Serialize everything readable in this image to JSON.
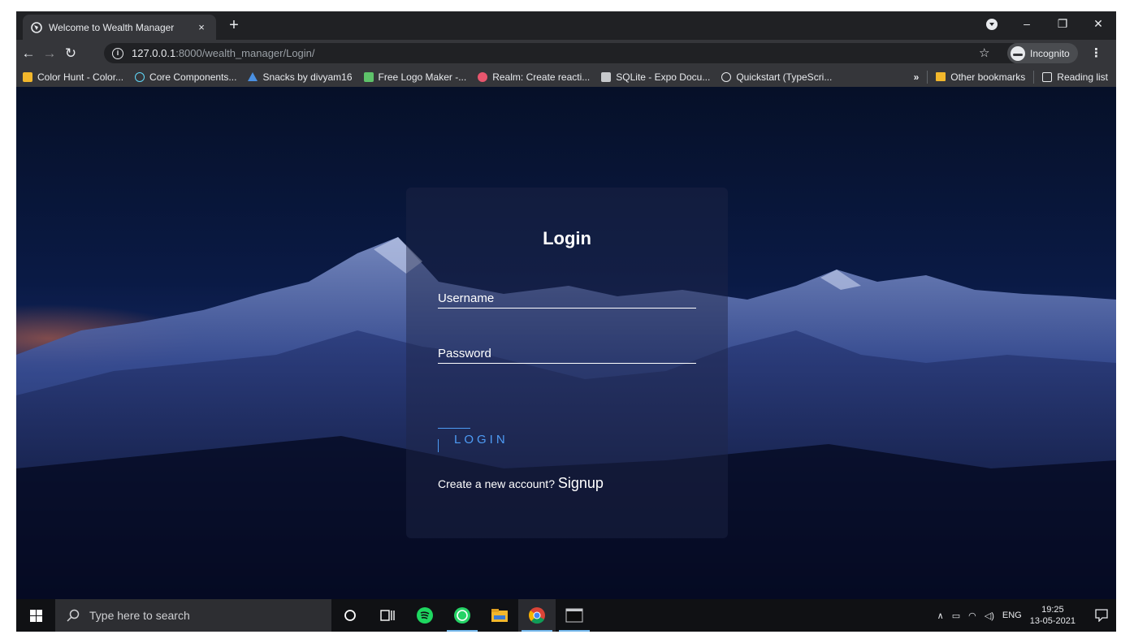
{
  "browser": {
    "tab_title": "Welcome to Wealth Manager",
    "tab_close": "×",
    "new_tab": "+",
    "window_controls": {
      "minimize": "–",
      "restore": "❐",
      "close": "✕"
    },
    "url_host": "127.0.0.1",
    "url_rest": ":8000/wealth_manager/Login/",
    "incognito_label": "Incognito",
    "bookmarks": [
      {
        "label": "Color Hunt - Color...",
        "color": "#f2b72c"
      },
      {
        "label": "Core Components...",
        "color": "#61dafb"
      },
      {
        "label": "Snacks by divyam16",
        "color": "#4a90e2"
      },
      {
        "label": "Free Logo Maker -...",
        "color": "#5ec26a"
      },
      {
        "label": "Realm: Create reacti...",
        "color": "#e8566e"
      },
      {
        "label": "SQLite - Expo Docu...",
        "color": "#c7c9cc"
      },
      {
        "label": "Quickstart (TypeScri...",
        "color": "#e8eaed"
      }
    ],
    "bookmarks_overflow": "»",
    "other_bookmarks": "Other bookmarks",
    "reading_list": "Reading list"
  },
  "login": {
    "title": "Login",
    "username_placeholder": "Username",
    "password_placeholder": "Password",
    "login_button": "LOGIN",
    "signup_prompt": "Create a new account? ",
    "signup_link": "Signup"
  },
  "taskbar": {
    "search_placeholder": "Type here to search",
    "language": "ENG",
    "time": "19:25",
    "date": "13-05-2021"
  },
  "colors": {
    "accent": "#4e9cf5",
    "browser_dark": "#202124",
    "toolbar": "#35363a"
  }
}
